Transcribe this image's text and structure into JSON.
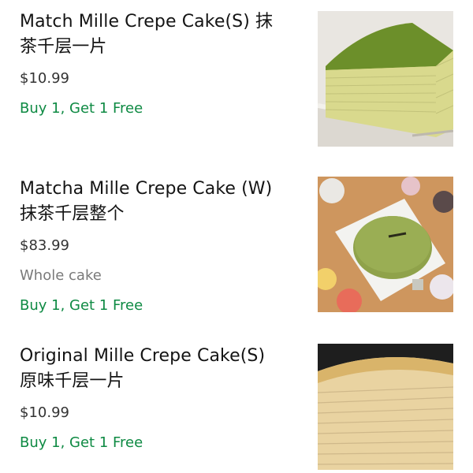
{
  "items": [
    {
      "title_line1": "Match Mille Crepe Cake(S) 抹",
      "title_line2": "茶千层一片",
      "price": "$10.99",
      "promo": "Buy 1, Get 1 Free",
      "image": "matcha-crepe-slice"
    },
    {
      "title_line1": "Matcha Mille Crepe Cake (W)",
      "title_line2": "抹茶千层整个",
      "price": "$83.99",
      "description": "Whole cake",
      "promo": "Buy 1, Get 1 Free",
      "image": "matcha-whole-cake"
    },
    {
      "title_line1": "Original Mille Crepe Cake(S)",
      "title_line2": "原味千层一片",
      "price": "$10.99",
      "promo": "Buy 1, Get 1 Free",
      "image": "original-crepe-slice"
    }
  ]
}
